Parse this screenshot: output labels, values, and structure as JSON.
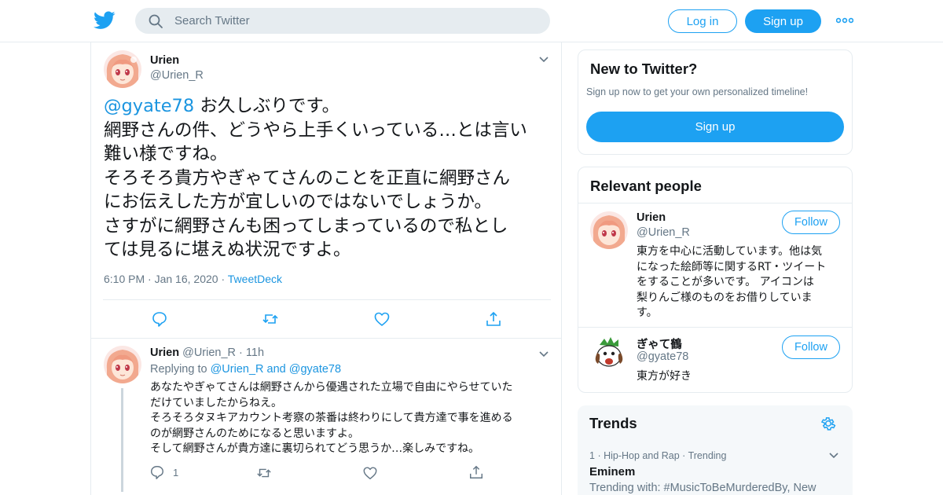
{
  "header": {
    "search_placeholder": "Search Twitter",
    "login_label": "Log in",
    "signup_label": "Sign up",
    "brand_color": "#1da1f2"
  },
  "tweet": {
    "name": "Urien",
    "handle": "@Urien_R",
    "mention": "@gyate78",
    "lines": [
      " お久しぶりです。",
      "網野さんの件、どうやら上手くいっている…とは言い",
      "難い様ですね。",
      "そろそろ貴方やぎゃてさんのことを正直に網野さん",
      "にお伝えした方が宜しいのではないでしょうか。",
      "さすがに網野さんも困ってしまっているので私とし",
      "ては見るに堪えぬ状況ですよ。"
    ],
    "time": "6:10 PM",
    "date": "Jan 16, 2020",
    "source": "TweetDeck",
    "sep": "·"
  },
  "reply": {
    "name": "Urien",
    "handle": "@Urien_R",
    "age": "11h",
    "replying_prefix": "Replying to ",
    "replying_to_1": "@Urien_R",
    "replying_and": " and ",
    "replying_to_2": "@gyate78",
    "lines": [
      "あなたやぎゃてさんは網野さんから優遇された立場で自由にやらせていた",
      "だけていましたからねえ。",
      "そろそろタヌキアカウント考察の茶番は終わりにして貴方達で事を進める",
      "のが網野さんのためになると思いますよ。",
      "そして網野さんが貴方達に裏切られてどう思うか…楽しみですね。"
    ],
    "reply_count": "1"
  },
  "new_to_twitter": {
    "title": "New to Twitter?",
    "subtitle": "Sign up now to get your own personalized timeline!",
    "signup_label": "Sign up"
  },
  "relevant": {
    "title": "Relevant people",
    "people": [
      {
        "name": "Urien",
        "handle": "@Urien_R",
        "follow_label": "Follow",
        "bio_lines": [
          "東方を中心に活動しています。他は気",
          "になった絵師等に関するRT・ツイート",
          "をすることが多いです。 アイコンは",
          "梨りんご様のものをお借りしていま",
          "す。"
        ]
      },
      {
        "name": "ぎゃて鶴",
        "handle": "@gyate78",
        "follow_label": "Follow",
        "bio_lines": [
          "東方が好き"
        ]
      }
    ]
  },
  "trends": {
    "title": "Trends",
    "items": [
      {
        "rank": "1",
        "category": "Hip-Hop and Rap",
        "status": "Trending",
        "name": "Eminem",
        "with": "Trending with: #MusicToBeMurderedBy, New"
      }
    ]
  }
}
